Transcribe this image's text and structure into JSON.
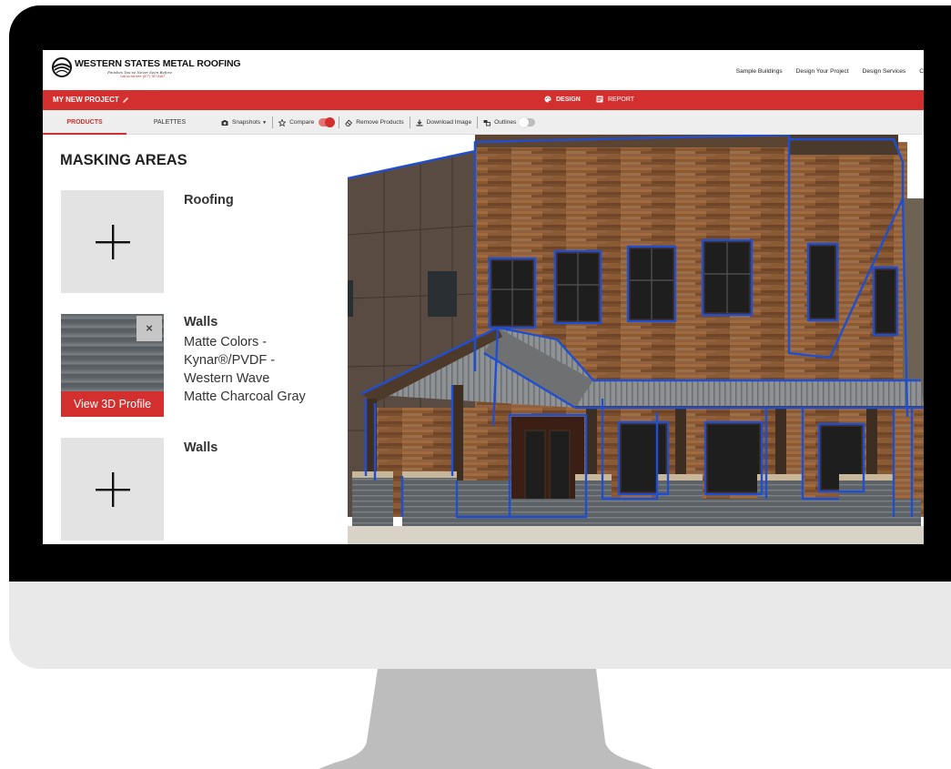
{
  "brand": {
    "name": "WESTERN STATES METAL ROOFING",
    "tagline": "Finishes You've Never Seen Before",
    "phone": "Call us toll free: (877) 787-5467"
  },
  "nav": {
    "links": [
      "Sample Buildings",
      "Design Your Project",
      "Design Services",
      "C"
    ]
  },
  "project": {
    "name": "MY NEW PROJECT",
    "modes": {
      "design": "DESIGN",
      "report": "REPORT"
    }
  },
  "sidebar_tabs": {
    "products": "PRODUCTS",
    "palettes": "PALETTES"
  },
  "toolbar": {
    "snapshots": "Snapshots",
    "compare": "Compare",
    "compare_on": true,
    "remove_products": "Remove Products",
    "download_image": "Download Image",
    "outlines": "Outlines",
    "outlines_on": false
  },
  "panel": {
    "title": "MASKING AREAS",
    "areas": [
      {
        "name": "Roofing"
      },
      {
        "name": "Walls",
        "detail": [
          "Matte Colors -",
          "Kynar®/PVDF -",
          "Western Wave",
          "Matte Charcoal Gray"
        ],
        "remove_label": "×",
        "view_label": "View 3D Profile"
      },
      {
        "name": "Walls"
      }
    ]
  },
  "colors": {
    "accent": "#d32f2f",
    "outline": "#1f4fd0",
    "wall_product": "#5d6266"
  }
}
